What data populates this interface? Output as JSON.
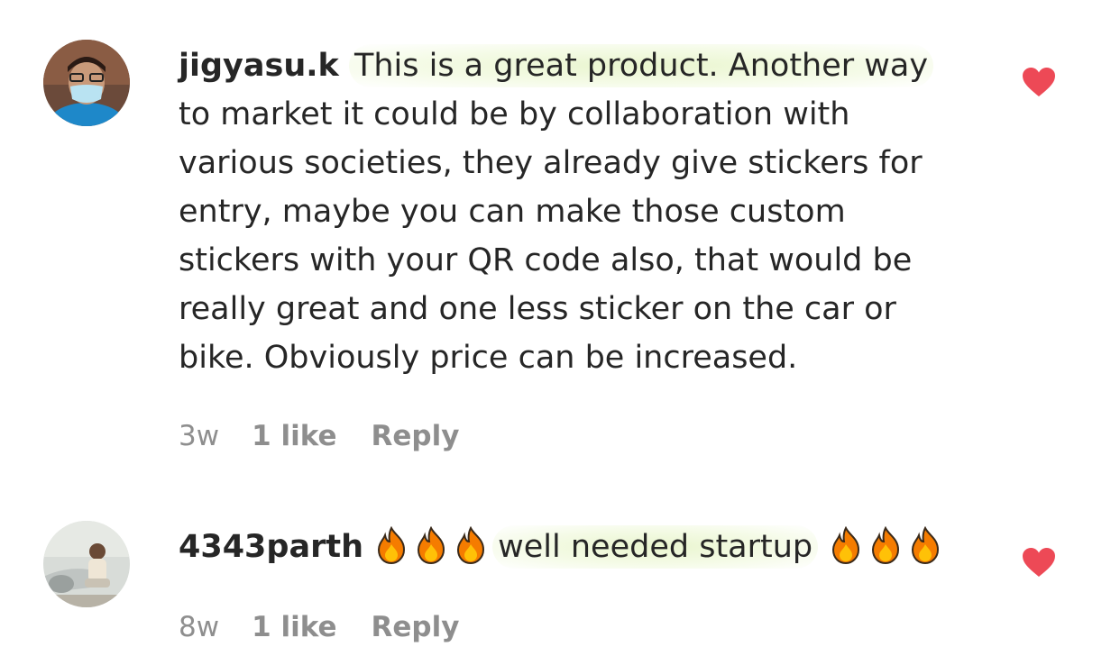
{
  "colors": {
    "text": "#262626",
    "secondary": "#8e8e8e",
    "like_heart": "#ed4956",
    "highlight": "#eaf6d0"
  },
  "comments": [
    {
      "username": "jigyasu.k",
      "text_highlighted": "This is a great product. Another way",
      "text_rest": "to market it could be by collaboration with various societies, they already give stickers for entry, maybe you can make those custom stickers with your QR code also, that would be really great and one less sticker on the car or bike. Obviously price can be increased.",
      "time": "3w",
      "likes": "1 like",
      "reply": "Reply",
      "avatar_icon": "avatar-person-mask",
      "liked_icon": "heart-filled-icon"
    },
    {
      "username": "4343parth",
      "emoji_before": "🔥🔥🔥",
      "text_highlighted": "well needed startup",
      "emoji_after": "🔥🔥🔥",
      "time": "8w",
      "likes": "1 like",
      "reply": "Reply",
      "avatar_icon": "avatar-person-car",
      "liked_icon": "heart-filled-icon"
    }
  ]
}
